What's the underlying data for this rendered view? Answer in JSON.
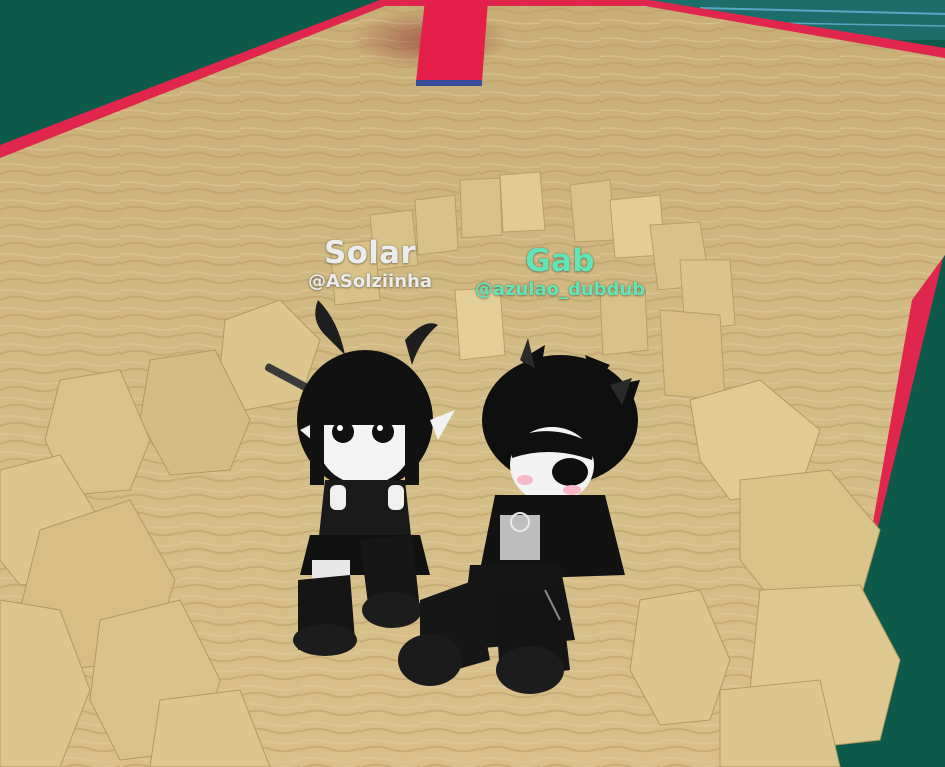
{
  "players": [
    {
      "display_name": "Solar",
      "username": "@ASolziinha",
      "color": "#ececec"
    },
    {
      "display_name": "Gab",
      "username": "@azulao_dubdub",
      "color": "#5ee6b8"
    }
  ],
  "colors": {
    "sand": "#cfb782",
    "sand_dark": "#b89c62",
    "border_red": "#e0264c",
    "grass": "#0e5a4a",
    "block": "#d9c48a",
    "outfit": "#141414"
  }
}
